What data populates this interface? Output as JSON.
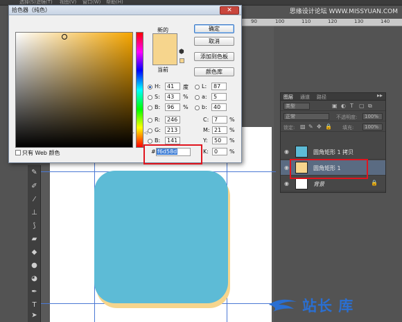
{
  "menubar": {
    "items": [
      "选择(S)",
      "滤镜(T)",
      "视图(V)",
      "窗口(W)",
      "帮助(H)"
    ]
  },
  "watermark": {
    "text": "思缘设计论坛 WWW.MISSYUAN.COM"
  },
  "ruler": {
    "ticks": [
      "90",
      "100",
      "110",
      "120",
      "130",
      "140"
    ]
  },
  "color_picker": {
    "title": "拾色器（纯色）",
    "close_label": "✕",
    "new_label": "新的",
    "current_label": "当前",
    "buttons": {
      "ok": "确定",
      "cancel": "取消",
      "add_to_swatches": "添加到色板",
      "color_libraries": "颜色库"
    },
    "hsb": [
      {
        "label": "H:",
        "value": "41",
        "unit": "度",
        "selected": true
      },
      {
        "label": "S:",
        "value": "43",
        "unit": "%",
        "selected": false
      },
      {
        "label": "B:",
        "value": "96",
        "unit": "%",
        "selected": false
      }
    ],
    "rgb": [
      {
        "label": "R:",
        "value": "246"
      },
      {
        "label": "G:",
        "value": "213"
      },
      {
        "label": "B:",
        "value": "141"
      }
    ],
    "lab": [
      {
        "label": "L:",
        "value": "87"
      },
      {
        "label": "a:",
        "value": "5"
      },
      {
        "label": "b:",
        "value": "40"
      }
    ],
    "cmyk": [
      {
        "label": "C:",
        "value": "7",
        "unit": "%"
      },
      {
        "label": "M:",
        "value": "21",
        "unit": "%"
      },
      {
        "label": "Y:",
        "value": "50",
        "unit": "%"
      },
      {
        "label": "K:",
        "value": "0",
        "unit": "%"
      }
    ],
    "hex_hash": "#",
    "hex_value": "f6d58d",
    "web_only_label": "只有 Web 颜色",
    "colors": {
      "new": "#f6d58d",
      "current": "#f6d58d"
    }
  },
  "canvas": {
    "shape_color": "#5dbbd6",
    "shadow_color": "#f6d58d"
  },
  "layers_panel": {
    "tabs": [
      "图层",
      "通道",
      "路径"
    ],
    "collapse": "▸▸",
    "filter_kind": "类型",
    "blend_mode": "正常",
    "opacity_label": "不透明度:",
    "opacity_value": "100%",
    "lock_label": "锁定:",
    "fill_label": "填充:",
    "fill_value": "100%",
    "layers": [
      {
        "name": "圆角矩形 1 拷贝",
        "thumb_color": "#5dbbd6",
        "selected": false
      },
      {
        "name": "圆角矩形 1",
        "thumb_color": "#f6d58d",
        "selected": true
      },
      {
        "name": "背景",
        "thumb_color": "#ffffff",
        "selected": false
      }
    ]
  },
  "logo": {
    "text": "站长 库"
  }
}
